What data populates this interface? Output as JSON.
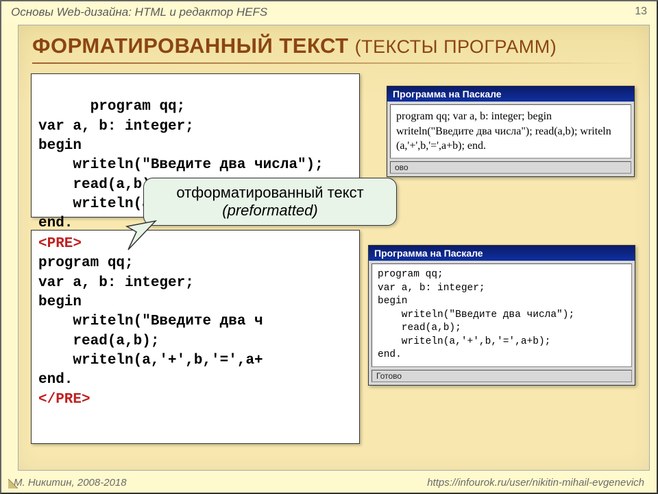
{
  "topbar": {
    "subject": "Основы Web-дизайна: HTML и редактор HEFS",
    "page": "13"
  },
  "title": {
    "main": "ФОРМАТИРОВАННЫЙ ТЕКСТ",
    "sub": "(ТЕКСТЫ ПРОГРАММ)"
  },
  "code1": "program qq;\nvar a, b: integer;\nbegin\n    writeln(\"Введите два числа\");\n    read(a,b);\n    writeln(a,'+',b,'=',a+b);\nend.",
  "code2_open": "<PRE>",
  "code2_body": "program qq;\nvar a, b: integer;\nbegin\n    writeln(\"Введите два ч\n    read(a,b);\n    writeln(a,'+',b,'=',a+\nend.",
  "code2_close": "</PRE>",
  "win1": {
    "title": "Программа на Паскале",
    "body": "program qq; var a, b: integer; begin writeln(\"Введите два числа\"); read(a,b); writeln (a,'+',b,'=',a+b); end.",
    "status": "ово"
  },
  "win2": {
    "title": "Программа на Паскале",
    "body": "program qq;\nvar a, b: integer;\nbegin\n    writeln(\"Введите два числа\");\n    read(a,b);\n    writeln(a,'+',b,'=',a+b);\nend.",
    "status": "Готово"
  },
  "callout": {
    "line1": "отформатированный текст",
    "line2": "(preformatted)"
  },
  "footer": {
    "author": "М. Никитин, 2008-2018",
    "url": "https://infourok.ru/user/nikitin-mihail-evgenevich"
  }
}
